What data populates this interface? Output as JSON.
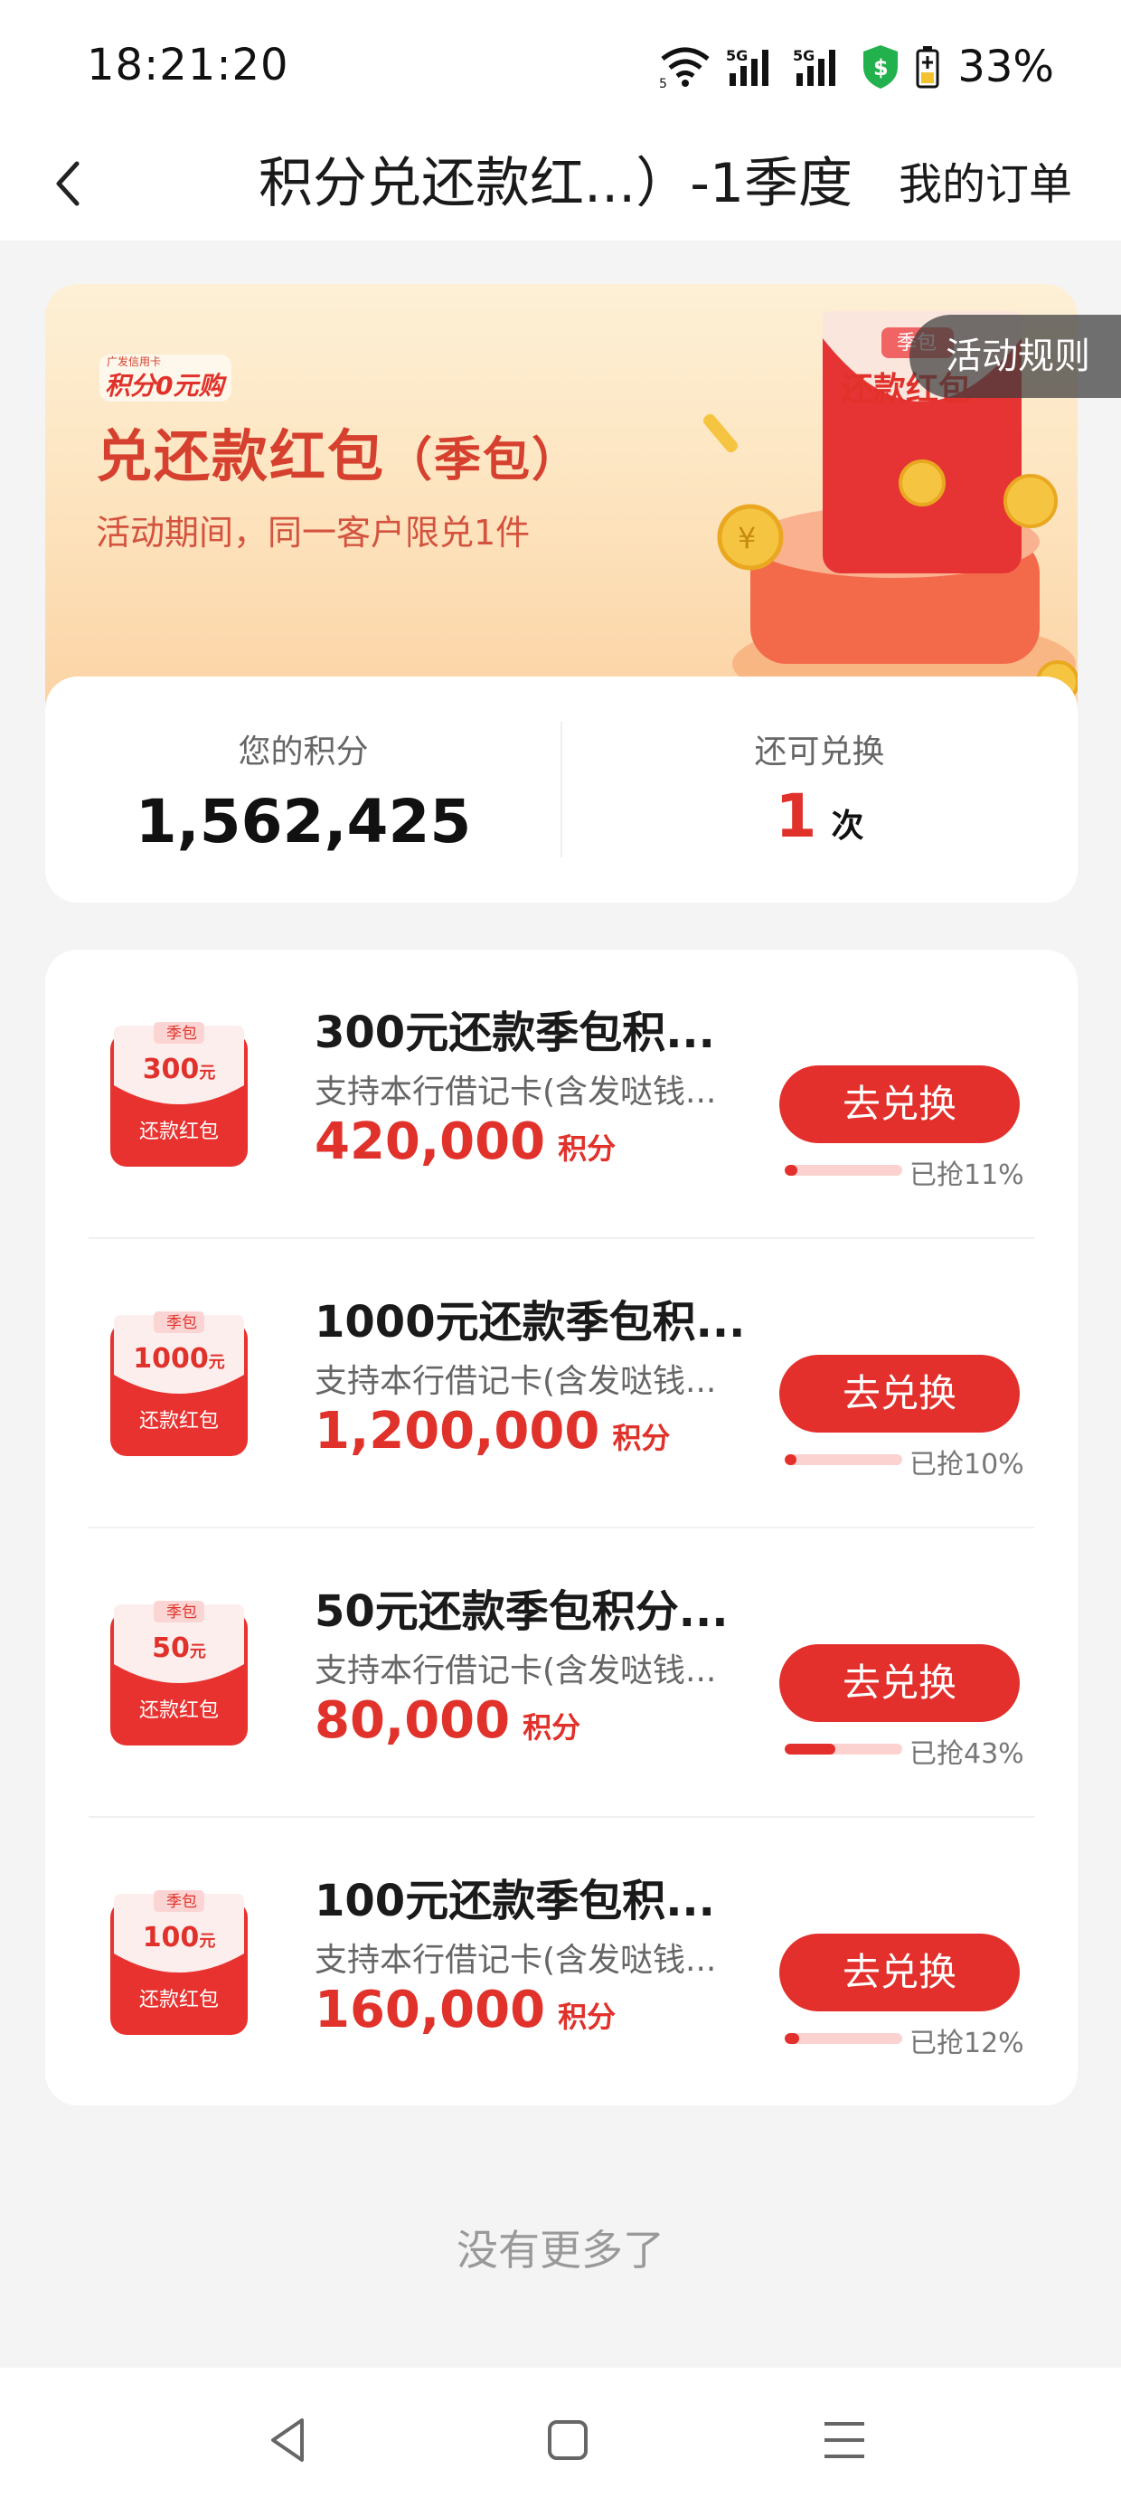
{
  "status_bar": {
    "time": "18:21:20",
    "battery_percent": "33%",
    "icons": [
      "wifi-icon",
      "signal-5g-icon",
      "signal-5g-icon",
      "shield-dollar-icon",
      "battery-icon"
    ]
  },
  "navbar": {
    "title": "积分兑还款红...）-1季度",
    "orders_label": "我的订单"
  },
  "banner": {
    "logo_small": "广发信用卡",
    "logo_big": "积分0元购",
    "title": "兑还款红包",
    "title_paren": "（季包）",
    "subtitle": "活动期间，同一客户限兑1件",
    "art_tag": "季包",
    "art_label": "还款红包",
    "rules_label": "活动规则"
  },
  "points": {
    "balance_label": "您的积分",
    "balance_value": "1,562,425",
    "remaining_label": "还可兑换",
    "remaining_value": "1",
    "remaining_unit": "次"
  },
  "items": [
    {
      "tag": "季包",
      "amount": "300",
      "amount_unit": "元",
      "pack_label": "还款红包",
      "title": "300元还款季包积...",
      "desc": "支持本行借记卡(含发哒钱...",
      "price": "420,000",
      "price_unit": "积分",
      "button": "去兑换",
      "progress": 0.11,
      "progress_text": "已抢11%"
    },
    {
      "tag": "季包",
      "amount": "1000",
      "amount_unit": "元",
      "pack_label": "还款红包",
      "title": "1000元还款季包积...",
      "desc": "支持本行借记卡(含发哒钱...",
      "price": "1,200,000",
      "price_unit": "积分",
      "button": "去兑换",
      "progress": 0.1,
      "progress_text": "已抢10%"
    },
    {
      "tag": "季包",
      "amount": "50",
      "amount_unit": "元",
      "pack_label": "还款红包",
      "title": "50元还款季包积分...",
      "desc": "支持本行借记卡(含发哒钱...",
      "price": "80,000",
      "price_unit": "积分",
      "button": "去兑换",
      "progress": 0.43,
      "progress_text": "已抢43%"
    },
    {
      "tag": "季包",
      "amount": "100",
      "amount_unit": "元",
      "pack_label": "还款红包",
      "title": "100元还款季包积...",
      "desc": "支持本行借记卡(含发哒钱...",
      "price": "160,000",
      "price_unit": "积分",
      "button": "去兑换",
      "progress": 0.12,
      "progress_text": "已抢12%"
    }
  ],
  "footer_text": "没有更多了",
  "colors": {
    "accent": "#e3302c",
    "banner_text": "#d6402e",
    "background": "#f4f4f4"
  }
}
